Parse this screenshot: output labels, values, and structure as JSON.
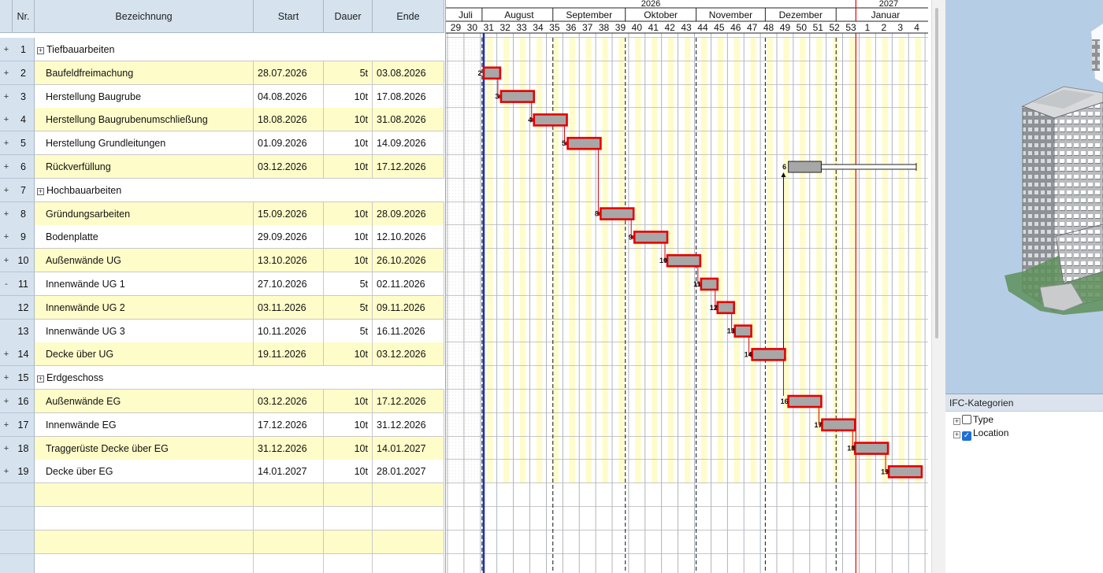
{
  "table": {
    "headers": {
      "nr": "Nr.",
      "bez": "Bezeichnung",
      "start": "Start",
      "dauer": "Dauer",
      "ende": "Ende"
    },
    "rows": [
      {
        "exp": "+",
        "nr": "1",
        "bez": "Tiefbauarbeiten",
        "group": true
      },
      {
        "exp": "+",
        "nr": "2",
        "bez": "Baufeldfreimachung",
        "start": "28.07.2026",
        "dauer": "5t",
        "ende": "03.08.2026"
      },
      {
        "exp": "+",
        "nr": "3",
        "bez": "Herstellung Baugrube",
        "start": "04.08.2026",
        "dauer": "10t",
        "ende": "17.08.2026"
      },
      {
        "exp": "+",
        "nr": "4",
        "bez": "Herstellung Baugrubenumschließung",
        "start": "18.08.2026",
        "dauer": "10t",
        "ende": "31.08.2026"
      },
      {
        "exp": "+",
        "nr": "5",
        "bez": "Herstellung Grundleitungen",
        "start": "01.09.2026",
        "dauer": "10t",
        "ende": "14.09.2026"
      },
      {
        "exp": "+",
        "nr": "6",
        "bez": "Rückverfüllung",
        "start": "03.12.2026",
        "dauer": "10t",
        "ende": "17.12.2026"
      },
      {
        "exp": "+",
        "nr": "7",
        "bez": "Hochbauarbeiten",
        "group": true
      },
      {
        "exp": "+",
        "nr": "8",
        "bez": "Gründungsarbeiten",
        "start": "15.09.2026",
        "dauer": "10t",
        "ende": "28.09.2026"
      },
      {
        "exp": "+",
        "nr": "9",
        "bez": "Bodenplatte",
        "start": "29.09.2026",
        "dauer": "10t",
        "ende": "12.10.2026"
      },
      {
        "exp": "+",
        "nr": "10",
        "bez": "Außenwände UG",
        "start": "13.10.2026",
        "dauer": "10t",
        "ende": "26.10.2026"
      },
      {
        "exp": "-",
        "nr": "11",
        "bez": "Innenwände UG 1",
        "start": "27.10.2026",
        "dauer": "5t",
        "ende": "02.11.2026"
      },
      {
        "exp": "",
        "nr": "12",
        "bez": "Innenwände UG 2",
        "start": "03.11.2026",
        "dauer": "5t",
        "ende": "09.11.2026"
      },
      {
        "exp": "",
        "nr": "13",
        "bez": "Innenwände UG 3",
        "start": "10.11.2026",
        "dauer": "5t",
        "ende": "16.11.2026"
      },
      {
        "exp": "+",
        "nr": "14",
        "bez": "Decke über UG",
        "start": "19.11.2026",
        "dauer": "10t",
        "ende": "03.12.2026"
      },
      {
        "exp": "+",
        "nr": "15",
        "bez": "Erdgeschoss",
        "group": true
      },
      {
        "exp": "+",
        "nr": "16",
        "bez": "Außenwände EG",
        "start": "03.12.2026",
        "dauer": "10t",
        "ende": "17.12.2026"
      },
      {
        "exp": "+",
        "nr": "17",
        "bez": "Innenwände EG",
        "start": "17.12.2026",
        "dauer": "10t",
        "ende": "31.12.2026"
      },
      {
        "exp": "+",
        "nr": "18",
        "bez": "Traggerüste Decke über EG",
        "start": "31.12.2026",
        "dauer": "10t",
        "ende": "14.01.2027"
      },
      {
        "exp": "+",
        "nr": "19",
        "bez": "Decke über EG",
        "start": "14.01.2027",
        "dauer": "10t",
        "ende": "28.01.2027"
      }
    ],
    "empty_rows": 4
  },
  "gantt": {
    "years": [
      "2026",
      "2027"
    ],
    "months": [
      "Juli",
      "August",
      "September",
      "Oktober",
      "November",
      "Dezember",
      "Januar"
    ],
    "weeks": [
      "29",
      "30",
      "31",
      "32",
      "33",
      "34",
      "35",
      "36",
      "37",
      "38",
      "39",
      "40",
      "41",
      "42",
      "43",
      "44",
      "45",
      "46",
      "47",
      "48",
      "49",
      "50",
      "51",
      "52",
      "53",
      "1",
      "2",
      "3",
      "4"
    ],
    "bar_labels": [
      "2",
      "3",
      "4",
      "5",
      "6",
      "8",
      "9",
      "10",
      "11",
      "12",
      "13",
      "14",
      "16",
      "17",
      "18",
      "19"
    ],
    "colors": {
      "bar_fill": "#a7a7a7",
      "bar_border": "#e60000",
      "today_line": "#1f2fbf",
      "year_line": "#e60000",
      "weekend": "#fefccb"
    }
  },
  "ifc": {
    "title": "IFC-Kategorien",
    "items": [
      {
        "label": "Type",
        "checked": false
      },
      {
        "label": "Location",
        "checked": true
      }
    ]
  }
}
